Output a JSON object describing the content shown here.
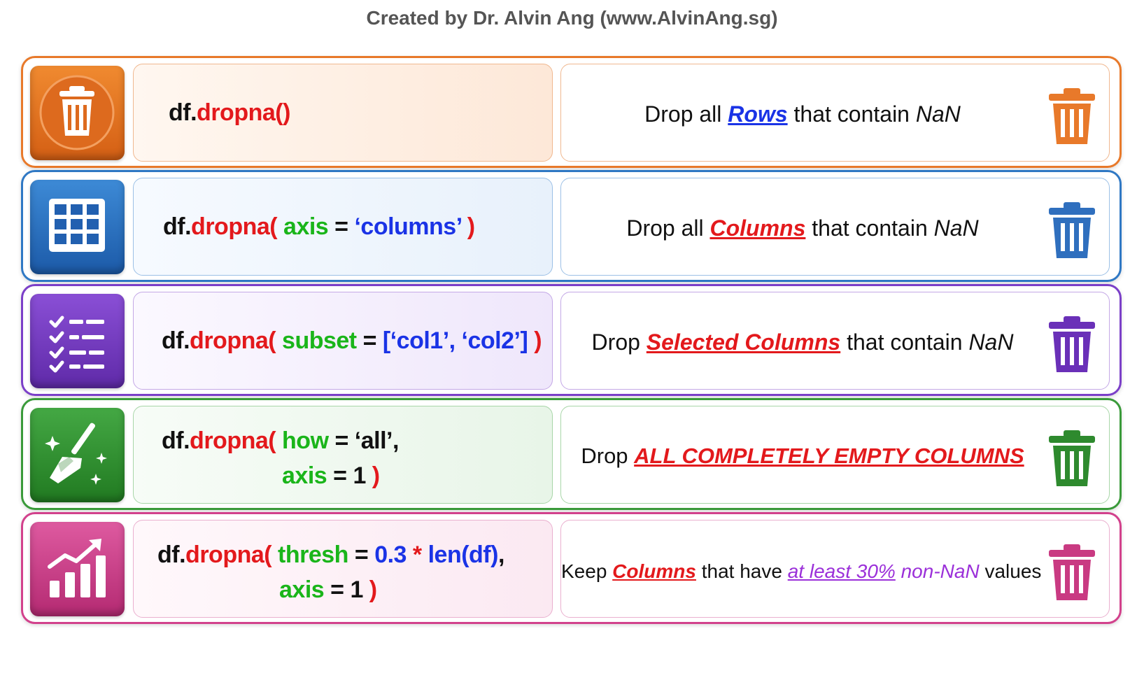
{
  "header": {
    "text": "Created by Dr. Alvin Ang (www.AlvinAng.sg)"
  },
  "rows": [
    {
      "accent": "#e8792a",
      "code": {
        "obj": "df.",
        "fn": "dropna()"
      },
      "desc": {
        "pre": "Drop all ",
        "em": "Rows",
        "post": " that contain ",
        "it": "NaN"
      },
      "em_color": "#1a33e6"
    },
    {
      "accent": "#2f78c4",
      "code": {
        "obj": "df.",
        "fn": "dropna(",
        "kw": " axis",
        "eq": " = ",
        "val": "‘columns’",
        "close": " )"
      },
      "desc": {
        "pre": "Drop all ",
        "em": "Columns",
        "post": " that contain ",
        "it": "NaN"
      },
      "em_color": "#e3191c"
    },
    {
      "accent": "#7b3fc8",
      "code": {
        "obj": "df.",
        "fn": "dropna(",
        "kw": " subset",
        "eq": " = ",
        "val": "[‘col1’, ‘col2’]",
        "close": " )"
      },
      "desc": {
        "pre": "Drop ",
        "em": "Selected Columns",
        "post": " that contain ",
        "it": "NaN"
      },
      "em_color": "#e3191c"
    },
    {
      "accent": "#3a9a3a",
      "code": {
        "obj": "df.",
        "fn": "dropna(",
        "kw": " how",
        "eq": " = ",
        "val": "‘all’",
        "comma": ",",
        "kw2": "axis",
        "eq2": " = ",
        "num2": "1",
        "close": " )"
      },
      "desc": {
        "pre": "Drop ",
        "em": "ALL COMPLETELY EMPTY COLUMNS"
      },
      "em_color": "#e3191c"
    },
    {
      "accent": "#d2418c",
      "code": {
        "obj": "df.",
        "fn": "dropna(",
        "kw": " thresh",
        "eq": " = ",
        "val": "0.3",
        "star": " * ",
        "fn2": "len",
        "arg": "(df)",
        "comma": ",",
        "kw2": "axis",
        "eq2": " = ",
        "num2": "1",
        "close": " )"
      },
      "desc": {
        "pre": "Keep ",
        "em": "Columns",
        "mid": " that have ",
        "em2": "at least 30%",
        "mid2": " non-NaN",
        "post": " values"
      },
      "em_color": "#e3191c",
      "em2_color": "#9b30d9"
    }
  ],
  "icons": [
    "trash-icon",
    "grid-icon",
    "checklist-icon",
    "broom-icon",
    "chart-growth-icon"
  ]
}
